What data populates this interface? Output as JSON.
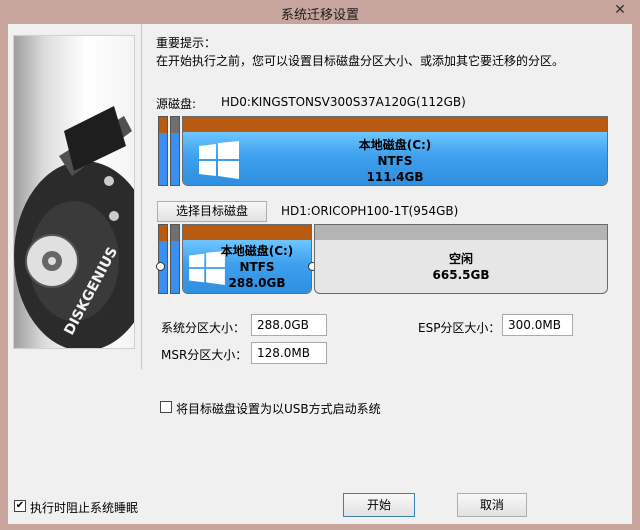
{
  "window": {
    "title": "系统迁移设置",
    "close_glyph": "✕"
  },
  "notice": {
    "heading": "重要提示：",
    "text": "在开始执行之前，您可以设置目标磁盘分区大小、或添加其它要迁移的分区。"
  },
  "source": {
    "label": "源磁盘:",
    "disk_name": "HD0:KINGSTONSV300S37A120G(112GB)",
    "partition": {
      "name": "本地磁盘(C:)",
      "fs": "NTFS",
      "size": "111.4GB"
    }
  },
  "target": {
    "select_button": "选择目标磁盘",
    "disk_name": "HD1:ORICOPH100-1T(954GB)",
    "partition": {
      "name": "本地磁盘(C:)",
      "fs": "NTFS",
      "size": "288.0GB"
    },
    "free": {
      "name": "空闲",
      "size": "665.5GB"
    }
  },
  "fields": {
    "system_size_label": "系统分区大小：",
    "system_size_value": "288.0GB",
    "esp_size_label": "ESP分区大小：",
    "esp_size_value": "300.0MB",
    "msr_size_label": "MSR分区大小：",
    "msr_size_value": "128.0MB"
  },
  "usb_boot": {
    "label": "将目标磁盘设置为以USB方式启动系统",
    "checked": false
  },
  "prevent_sleep": {
    "label": "执行时阻止系统睡眠",
    "checked": true,
    "check_glyph": "✔"
  },
  "buttons": {
    "start": "开始",
    "cancel": "取消"
  },
  "logo_text": "DISKGENIUS",
  "colors": {
    "partition_cap": "#b85a10",
    "partition_fill": "#3ea0ee",
    "free_space": "#e6e6e6",
    "window_frame": "#c7a59c"
  }
}
